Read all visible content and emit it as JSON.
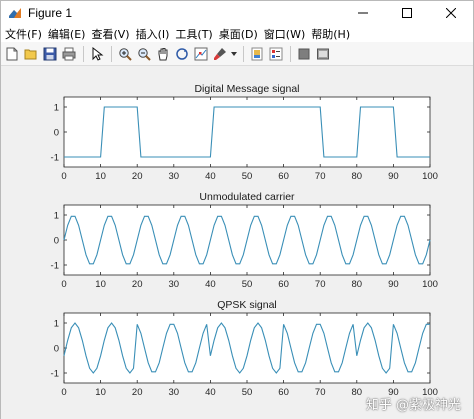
{
  "window": {
    "title": "Figure 1"
  },
  "menu": [
    "文件(F)",
    "编辑(E)",
    "查看(V)",
    "插入(I)",
    "工具(T)",
    "桌面(D)",
    "窗口(W)",
    "帮助(H)"
  ],
  "toolbar": {
    "icons": [
      "new-figure-icon",
      "open-file-icon",
      "save-icon",
      "print-icon",
      "edit-plot-icon",
      "zoom-in-icon",
      "zoom-out-icon",
      "pan-icon",
      "rotate-3d-icon",
      "data-cursor-icon",
      "brush-icon",
      "link-plot-icon",
      "insert-colorbar-icon",
      "insert-legend-icon",
      "hide-plot-tools-icon",
      "show-plot-tools-icon"
    ]
  },
  "watermark": "知乎 @紫极神光",
  "colors": {
    "line": "#3a8fb7",
    "axes_bg": "#ffffff",
    "figure_bg": "#f0f0f0"
  },
  "chart_data": [
    {
      "type": "line",
      "title": "Digital Message signal",
      "xlim": [
        0,
        100
      ],
      "ylim": [
        -1.4,
        1.4
      ],
      "xticks": [
        0,
        10,
        20,
        30,
        40,
        50,
        60,
        70,
        80,
        90,
        100
      ],
      "yticks": [
        1,
        0,
        -1
      ],
      "x": [
        0,
        10,
        11,
        20,
        21,
        40,
        41,
        70,
        71,
        80,
        81,
        90,
        91,
        100
      ],
      "y": [
        -1,
        -1,
        1,
        1,
        -1,
        -1,
        1,
        1,
        -1,
        -1,
        1,
        1,
        -1,
        -1
      ]
    },
    {
      "type": "line",
      "title": "Unmodulated carrier",
      "xlim": [
        0,
        100
      ],
      "ylim": [
        -1.4,
        1.4
      ],
      "xticks": [
        0,
        10,
        20,
        30,
        40,
        50,
        60,
        70,
        80,
        90,
        100
      ],
      "yticks": [
        1,
        0,
        -1
      ],
      "x": [
        0,
        1,
        2,
        3,
        4,
        5,
        6,
        7,
        8,
        9,
        10,
        11,
        12,
        13,
        14,
        15,
        16,
        17,
        18,
        19,
        20,
        21,
        22,
        23,
        24,
        25,
        26,
        27,
        28,
        29,
        30,
        31,
        32,
        33,
        34,
        35,
        36,
        37,
        38,
        39,
        40,
        41,
        42,
        43,
        44,
        45,
        46,
        47,
        48,
        49,
        50,
        51,
        52,
        53,
        54,
        55,
        56,
        57,
        58,
        59,
        60,
        61,
        62,
        63,
        64,
        65,
        66,
        67,
        68,
        69,
        70,
        71,
        72,
        73,
        74,
        75,
        76,
        77,
        78,
        79,
        80,
        81,
        82,
        83,
        84,
        85,
        86,
        87,
        88,
        89,
        90,
        91,
        92,
        93,
        94,
        95,
        96,
        97,
        98,
        99,
        100
      ],
      "y": [
        0.0,
        0.59,
        0.95,
        0.95,
        0.59,
        0.0,
        -0.59,
        -0.95,
        -0.95,
        -0.59,
        0.0,
        0.59,
        0.95,
        0.95,
        0.59,
        0.0,
        -0.59,
        -0.95,
        -0.95,
        -0.59,
        0.0,
        0.59,
        0.95,
        0.95,
        0.59,
        0.0,
        -0.59,
        -0.95,
        -0.95,
        -0.59,
        0.0,
        0.59,
        0.95,
        0.95,
        0.59,
        0.0,
        -0.59,
        -0.95,
        -0.95,
        -0.59,
        0.0,
        0.59,
        0.95,
        0.95,
        0.59,
        0.0,
        -0.59,
        -0.95,
        -0.95,
        -0.59,
        0.0,
        0.59,
        0.95,
        0.95,
        0.59,
        0.0,
        -0.59,
        -0.95,
        -0.95,
        -0.59,
        0.0,
        0.59,
        0.95,
        0.95,
        0.59,
        0.0,
        -0.59,
        -0.95,
        -0.95,
        -0.59,
        0.0,
        0.59,
        0.95,
        0.95,
        0.59,
        0.0,
        -0.59,
        -0.95,
        -0.95,
        -0.59,
        0.0,
        0.59,
        0.95,
        0.95,
        0.59,
        0.0,
        -0.59,
        -0.95,
        -0.95,
        -0.59,
        0.0,
        0.59,
        0.95,
        0.95,
        0.59,
        0.0,
        -0.59,
        -0.95,
        -0.95,
        -0.59,
        0.0
      ]
    },
    {
      "type": "line",
      "title": "QPSK signal",
      "xlim": [
        0,
        100
      ],
      "ylim": [
        -1.4,
        1.4
      ],
      "xticks": [
        0,
        10,
        20,
        30,
        40,
        50,
        60,
        70,
        80,
        90,
        100
      ],
      "yticks": [
        1,
        0,
        -1
      ],
      "x": [
        0,
        1,
        2,
        3,
        4,
        5,
        6,
        7,
        8,
        9,
        10,
        11,
        12,
        13,
        14,
        15,
        16,
        17,
        18,
        19,
        20,
        21,
        22,
        23,
        24,
        25,
        26,
        27,
        28,
        29,
        30,
        31,
        32,
        33,
        34,
        35,
        36,
        37,
        38,
        39,
        40,
        41,
        42,
        43,
        44,
        45,
        46,
        47,
        48,
        49,
        50,
        51,
        52,
        53,
        54,
        55,
        56,
        57,
        58,
        59,
        60,
        61,
        62,
        63,
        64,
        65,
        66,
        67,
        68,
        69,
        70,
        71,
        72,
        73,
        74,
        75,
        76,
        77,
        78,
        79,
        80,
        81,
        82,
        83,
        84,
        85,
        86,
        87,
        88,
        89,
        90,
        91,
        92,
        93,
        94,
        95,
        96,
        97,
        98,
        99,
        100
      ],
      "y": [
        -0.31,
        0.31,
        0.81,
        1.0,
        0.81,
        0.31,
        -0.31,
        -0.81,
        -1.0,
        -0.81,
        -0.31,
        0.31,
        0.81,
        1.0,
        0.81,
        0.31,
        -0.31,
        -0.81,
        -1.0,
        -0.81,
        0.95,
        0.59,
        0.0,
        -0.59,
        -0.95,
        -0.95,
        -0.59,
        0.0,
        0.59,
        0.95,
        0.95,
        0.59,
        0.0,
        -0.59,
        -0.95,
        -0.95,
        -0.59,
        0.0,
        0.59,
        0.95,
        -0.31,
        0.31,
        0.81,
        1.0,
        0.81,
        0.31,
        -0.31,
        -0.81,
        -1.0,
        -0.81,
        -0.31,
        0.31,
        0.81,
        1.0,
        0.81,
        0.31,
        -0.31,
        -0.81,
        -1.0,
        -0.81,
        0.95,
        0.59,
        0.0,
        -0.59,
        -0.95,
        -0.95,
        -0.59,
        0.0,
        0.59,
        0.95,
        0.95,
        0.59,
        0.0,
        -0.59,
        -0.95,
        -0.95,
        -0.59,
        0.0,
        0.59,
        0.95,
        -0.31,
        0.31,
        0.81,
        1.0,
        0.81,
        0.31,
        -0.31,
        -0.81,
        -1.0,
        -0.81,
        0.95,
        0.59,
        0.0,
        -0.59,
        -0.95,
        -0.95,
        -0.59,
        0.0,
        0.59,
        0.95,
        0.95
      ]
    }
  ]
}
